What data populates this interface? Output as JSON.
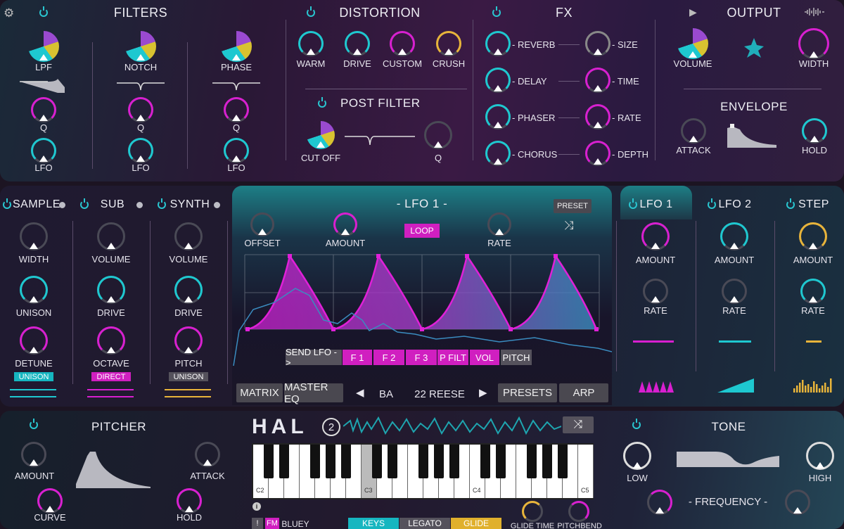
{
  "colors": {
    "magenta": "#d81fd0",
    "teal": "#1ec8d0",
    "yellow": "#e8b43a",
    "grey": "#55525c"
  },
  "filters": {
    "title": "FILTERS",
    "knobs": [
      {
        "name": "LPF",
        "q": "Q",
        "lfo": "LFO"
      },
      {
        "name": "NOTCH",
        "q": "Q",
        "lfo": "LFO"
      },
      {
        "name": "PHASE",
        "q": "Q",
        "lfo": "LFO"
      }
    ]
  },
  "distortion": {
    "title": "DISTORTION",
    "knobs": [
      "WARM",
      "DRIVE",
      "CUSTOM",
      "CRUSH"
    ]
  },
  "post_filter": {
    "title": "POST FILTER",
    "cutoff": "CUT OFF",
    "q": "Q"
  },
  "fx": {
    "title": "FX",
    "left": [
      "- REVERB",
      "- DELAY",
      "- PHASER",
      "- CHORUS"
    ],
    "right": [
      "- SIZE",
      "- TIME",
      "- RATE",
      "- DEPTH"
    ]
  },
  "output": {
    "title": "OUTPUT",
    "volume": "VOLUME",
    "width": "WIDTH"
  },
  "envelope": {
    "title": "ENVELOPE",
    "attack": "ATTACK",
    "hold": "HOLD"
  },
  "sample": {
    "title": "SAMPLE",
    "width": "WIDTH",
    "unison": "UNISON",
    "detune": "DETUNE",
    "chip": "UNISON"
  },
  "sub": {
    "title": "SUB",
    "volume": "VOLUME",
    "drive": "DRIVE",
    "octave": "OCTAVE",
    "chip": "DIRECT"
  },
  "synth": {
    "title": "SYNTH",
    "volume": "VOLUME",
    "drive": "DRIVE",
    "pitch": "PITCH",
    "chip": "UNISON"
  },
  "lfo_editor": {
    "title": "- LFO 1 -",
    "preset": "PRESET",
    "offset": "OFFSET",
    "amount": "AMOUNT",
    "loop": "LOOP",
    "rate": "RATE",
    "send": [
      "SEND LFO ->",
      "F 1",
      "F 2",
      "F 3",
      "P FILT",
      "VOL",
      "PITCH"
    ]
  },
  "mod_tabs": [
    {
      "title": "LFO 1",
      "amount": "AMOUNT",
      "rate": "RATE"
    },
    {
      "title": "LFO 2",
      "amount": "AMOUNT",
      "rate": "RATE"
    },
    {
      "title": "STEP",
      "amount": "AMOUNT",
      "rate": "RATE"
    }
  ],
  "nav": {
    "matrix": "MATRIX",
    "master_eq": "MASTER EQ",
    "bank": "BA",
    "preset": "22 REESE",
    "presets": "PRESETS",
    "arp": "ARP"
  },
  "pitcher": {
    "title": "PITCHER",
    "amount": "AMOUNT",
    "attack": "ATTACK",
    "curve": "CURVE",
    "hold": "HOLD"
  },
  "logo": {
    "text": "HAL",
    "num": "2"
  },
  "keyboard": {
    "labels": [
      "C2",
      "C3",
      "C4",
      "C5"
    ],
    "pressed_index": 7
  },
  "bottom_bar": {
    "excl": "!",
    "fm": "FM",
    "name": "BLUEY",
    "keys": "KEYS",
    "legato": "LEGATO",
    "glide": "GLIDE",
    "glide_time": "GLIDE TIME",
    "pitchbend": "PITCHBEND"
  },
  "tone": {
    "title": "TONE",
    "low": "LOW",
    "high": "HIGH",
    "frequency": "- FREQUENCY -"
  }
}
